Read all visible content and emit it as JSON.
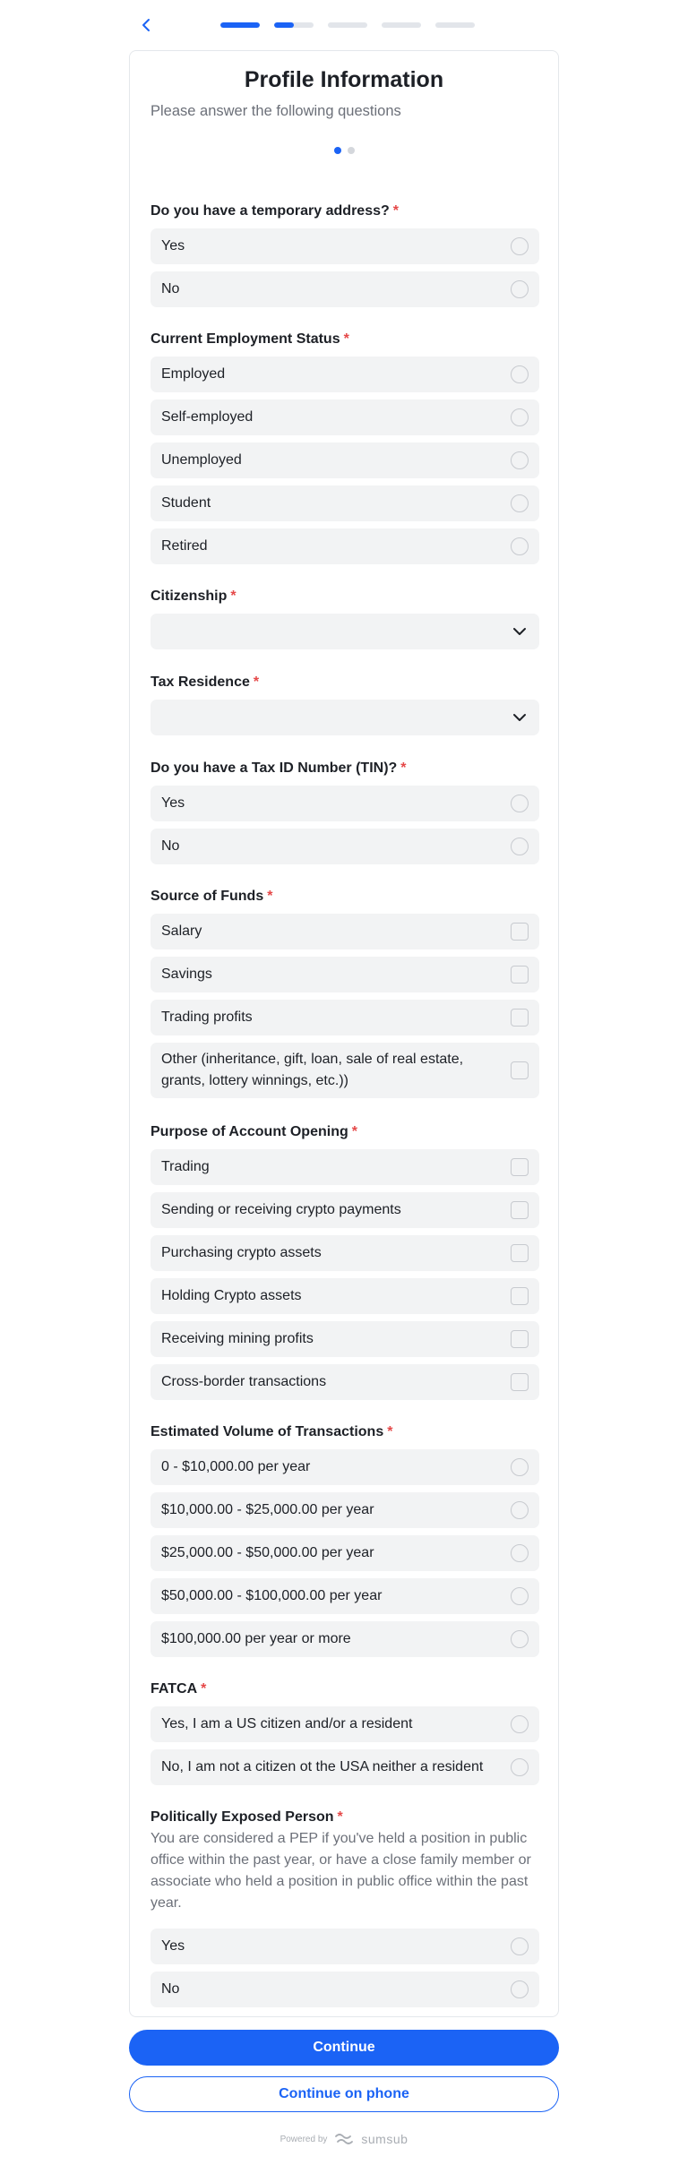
{
  "header": {
    "back_icon": "chevron-left-icon",
    "steps_progress": [
      1,
      0.5,
      0,
      0,
      0
    ]
  },
  "card": {
    "title": "Profile Information",
    "subtitle": "Please answer the following questions",
    "page_dots": {
      "count": 2,
      "active": 1
    }
  },
  "questions": {
    "temp_address": {
      "label": "Do you have a temporary address?",
      "options": [
        "Yes",
        "No"
      ]
    },
    "employment": {
      "label": "Current Employment Status",
      "options": [
        "Employed",
        "Self-employed",
        "Unemployed",
        "Student",
        "Retired"
      ]
    },
    "citizenship": {
      "label": "Citizenship",
      "value": ""
    },
    "tax_residence": {
      "label": "Tax Residence",
      "value": ""
    },
    "tin": {
      "label": "Do you have a Tax ID Number (TIN)?",
      "options": [
        "Yes",
        "No"
      ]
    },
    "funds": {
      "label": "Source of Funds",
      "options": [
        "Salary",
        "Savings",
        "Trading profits",
        "Other (inheritance, gift, loan, sale of real estate, grants, lottery winnings, etc.))"
      ]
    },
    "purpose": {
      "label": "Purpose of Account Opening",
      "options": [
        "Trading",
        "Sending or receiving crypto payments",
        "Purchasing crypto assets",
        "Holding Crypto assets",
        "Receiving mining profits",
        "Cross-border transactions"
      ]
    },
    "volume": {
      "label": "Estimated Volume of Transactions",
      "options": [
        "0 - $10,000.00 per year",
        "$10,000.00 - $25,000.00 per year",
        "$25,000.00 - $50,000.00 per year",
        "$50,000.00 - $100,000.00 per year",
        "$100,000.00 per year or more"
      ]
    },
    "fatca": {
      "label": "FATCA",
      "options": [
        "Yes, I am a US citizen and/or a resident",
        "No, I am not a citizen ot the USA neither a resident"
      ]
    },
    "pep": {
      "label": "Politically Exposed Person",
      "description": "You are considered a PEP if you've held a position in public office within the past year, or have a close family member or associate who held a position in public office within the past year.",
      "options": [
        "Yes",
        "No"
      ]
    },
    "required_mark": "*"
  },
  "actions": {
    "continue_label": "Continue",
    "continue_phone_label": "Continue on phone"
  },
  "footer": {
    "powered_by": "Powered by",
    "brand": "sumsub"
  },
  "colors": {
    "accent": "#1b63f5",
    "required": "#e54848",
    "option_bg": "#f2f3f4"
  }
}
